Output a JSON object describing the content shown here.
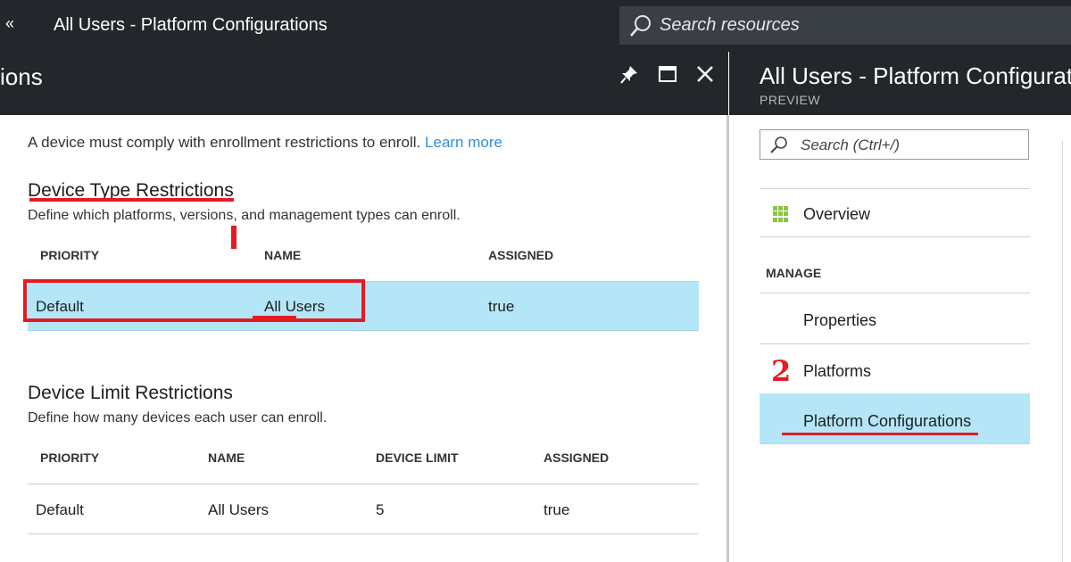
{
  "topbar": {
    "collapse": "«",
    "title": "All Users - Platform Configurations",
    "search_placeholder": "Search resources"
  },
  "blade": {
    "title_visible": "ions",
    "intro_text": "A device must comply with enrollment restrictions to enroll.",
    "learn_more": "Learn more",
    "device_type": {
      "heading": "Device Type Restrictions",
      "description": "Define which platforms, versions, and management types can enroll.",
      "columns": [
        "PRIORITY",
        "NAME",
        "ASSIGNED"
      ],
      "rows": [
        {
          "priority": "Default",
          "name": "All Users",
          "assigned": "true"
        }
      ]
    },
    "device_limit": {
      "heading": "Device Limit Restrictions",
      "description": "Define how many devices each user can enroll.",
      "columns": [
        "PRIORITY",
        "NAME",
        "DEVICE LIMIT",
        "ASSIGNED"
      ],
      "rows": [
        {
          "priority": "Default",
          "name": "All Users",
          "limit": "5",
          "assigned": "true"
        }
      ]
    }
  },
  "right": {
    "title": "All Users - Platform Configuration",
    "subtitle": "PREVIEW",
    "search_placeholder": "Search (Ctrl+/)",
    "overview": "Overview",
    "manage_header": "MANAGE",
    "properties": "Properties",
    "platforms": "Platforms",
    "platform_configs": "Platform Configurations",
    "annotation_number": "2"
  },
  "icons": {
    "search": "search-icon",
    "pin": "pin-icon",
    "maximize": "maximize-icon",
    "close": "close-icon",
    "overview": "grid-icon"
  },
  "colors": {
    "chrome": "#23272b",
    "selection": "#b4e6f8",
    "annotation": "#e31b23",
    "link": "#2f8fd8"
  }
}
